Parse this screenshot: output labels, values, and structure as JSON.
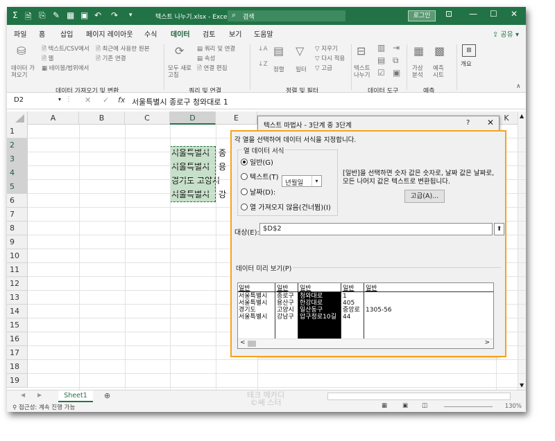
{
  "window": {
    "title": "텍스트 나누기.xlsx  -  Excel",
    "search_label": "검색",
    "login_label": "로그인"
  },
  "ribbon_tabs": [
    "파일",
    "홈",
    "삽입",
    "페이지 레이아웃",
    "수식",
    "데이터",
    "검토",
    "보기",
    "도움말"
  ],
  "share_label": "공유",
  "ribbon": {
    "get_data": "데이터 가져오기",
    "from_text_csv": "텍스트/CSV에서",
    "recent_sources": "최근에 사용한 원본",
    "from_web": "웹",
    "existing_connections": "기존 연결",
    "from_table": "테이블/범위에서",
    "refresh_all": "모두 새로 고침",
    "queries_connections": "쿼리 및 연결",
    "properties": "속성",
    "edit_links": "연결 편집",
    "sort": "정렬",
    "filter": "필터",
    "clear": "지우기",
    "reapply": "다시 적용",
    "advanced": "고급",
    "text_to_columns": "텍스트 나누기",
    "what_if": "가상 분석",
    "forecast_sheet": "예측 시트",
    "outline": "개요",
    "group_get_transform": "데이터 가져오기 및 변환",
    "group_queries": "쿼리 및 연결",
    "group_sort_filter": "정렬 및 필터",
    "group_data_tools": "데이터 도구",
    "group_forecast": "예측"
  },
  "formula_bar": {
    "name_box": "D2",
    "content": "서울특별시 종로구 청와대로 1"
  },
  "grid": {
    "columns": [
      "A",
      "B",
      "C",
      "D",
      "E",
      "K"
    ],
    "rows": [
      "1",
      "2",
      "3",
      "4",
      "5",
      "6",
      "7",
      "8",
      "9",
      "10",
      "11",
      "12",
      "13",
      "14",
      "15",
      "16",
      "17",
      "18",
      "19"
    ],
    "cells_d": [
      "서울특별시 종로구 청와대로 1",
      "서울특별시 용산구 한강대로 405",
      "경기도 고양시 일산동구 중앙로 1305-56",
      "서울특별시 강남구 압구정로10길 44"
    ],
    "cells_d_visible": [
      "서울특별시",
      "서울특별시",
      "경기도 고양시",
      "서울특별시"
    ],
    "cells_e_visible": [
      "종",
      "용",
      "",
      "강"
    ]
  },
  "sheet": {
    "tab_name": "Sheet1"
  },
  "status": {
    "text": "접근성: 계속 진행 가능",
    "zoom": "130%"
  },
  "watermark": {
    "line1": "테크 메카디",
    "line2": "©쎄 스터"
  },
  "dialog": {
    "title": "텍스트 마법사 - 3단계 중 3단계",
    "help": "?",
    "close": "✕",
    "instruction": "각 열을 선택하여 데이터 서식을 지정합니다.",
    "format_legend": "열 데이터 서식",
    "radio_general": "일반(G)",
    "radio_text": "텍스트(T)",
    "radio_date": "날짜(D):",
    "date_format": "년월일",
    "radio_skip": "열 가져오지 않음(건너뜀)(I)",
    "description_line1": "[일반]을 선택하면 숫자 값은 숫자로, 날짜 값은 날짜로,",
    "description_line2": "모든 나머지 값은 텍스트로 변환됩니다.",
    "advanced_button": "고급(A)...",
    "destination_label": "대상(E):",
    "destination_value": "$D$2",
    "preview_label": "데이터 미리 보기(P)",
    "preview_headers": [
      "일반",
      "일반",
      "일반",
      "일반",
      "일반"
    ],
    "preview_rows": [
      [
        "서울특별시",
        "종로구",
        "청와대로",
        "1",
        ""
      ],
      [
        "서울특별시",
        "용산구",
        "한강대로",
        "405",
        ""
      ],
      [
        "경기도",
        "고양시",
        "일산동구",
        "중앙로",
        "1305-56"
      ],
      [
        "서울특별시",
        "강남구",
        "압구정로10길",
        "44",
        ""
      ]
    ]
  },
  "colors": {
    "excel_green": "#217346",
    "highlight_orange": "#f5a31a",
    "selection_fill": "#c6e0c9"
  }
}
